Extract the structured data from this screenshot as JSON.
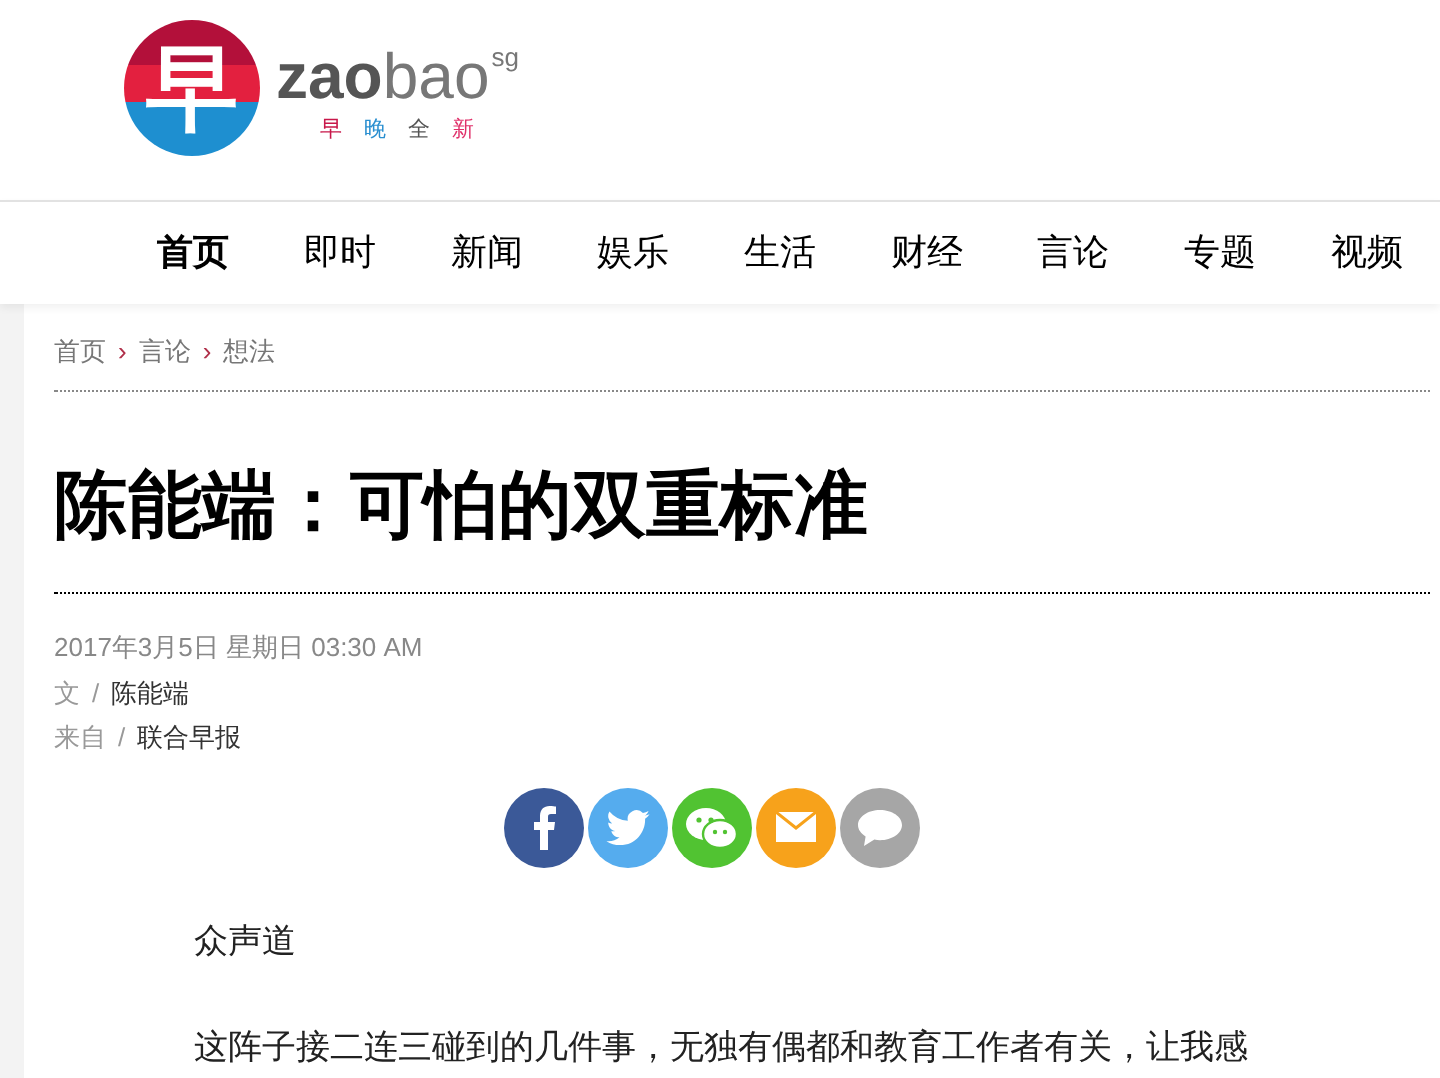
{
  "logo": {
    "mark": "早",
    "name_bold": "zao",
    "name_light": "bao",
    "suffix": "sg",
    "tagline": [
      {
        "char": "早",
        "color": "#c8174a"
      },
      {
        "char": "晚",
        "color": "#2a8fd0"
      },
      {
        "char": "全",
        "color": "#555555"
      },
      {
        "char": "新",
        "color": "#e0306a"
      }
    ]
  },
  "nav": [
    {
      "label": "首页",
      "selected": true
    },
    {
      "label": "即时",
      "selected": false
    },
    {
      "label": "新闻",
      "selected": false
    },
    {
      "label": "娱乐",
      "selected": false
    },
    {
      "label": "生活",
      "selected": false
    },
    {
      "label": "财经",
      "selected": false
    },
    {
      "label": "言论",
      "selected": false
    },
    {
      "label": "专题",
      "selected": false
    },
    {
      "label": "视频",
      "selected": false
    }
  ],
  "breadcrumb": [
    {
      "label": "首页",
      "separator": "›"
    },
    {
      "label": "言论",
      "separator": "›"
    },
    {
      "label": "想法"
    }
  ],
  "article": {
    "title": "陈能端：可怕的双重标准",
    "date": "2017年3月5日 星期日 03:30 AM",
    "meta": [
      {
        "label": "文",
        "separator": "/",
        "value": "陈能端"
      },
      {
        "label": "来自",
        "separator": "/",
        "value": "联合早报"
      }
    ],
    "share": [
      {
        "kind": "facebook",
        "color": "#3b5998"
      },
      {
        "kind": "twitter",
        "color": "#55acee"
      },
      {
        "kind": "wechat",
        "color": "#51c332"
      },
      {
        "kind": "email",
        "color": "#f7a21b"
      },
      {
        "kind": "comment",
        "color": "#a6a6a6"
      }
    ],
    "paragraphs": [
      "众声道",
      "这阵子接二连三碰到的几件事，无独有偶都和教育工作者有关，让我感"
    ]
  }
}
